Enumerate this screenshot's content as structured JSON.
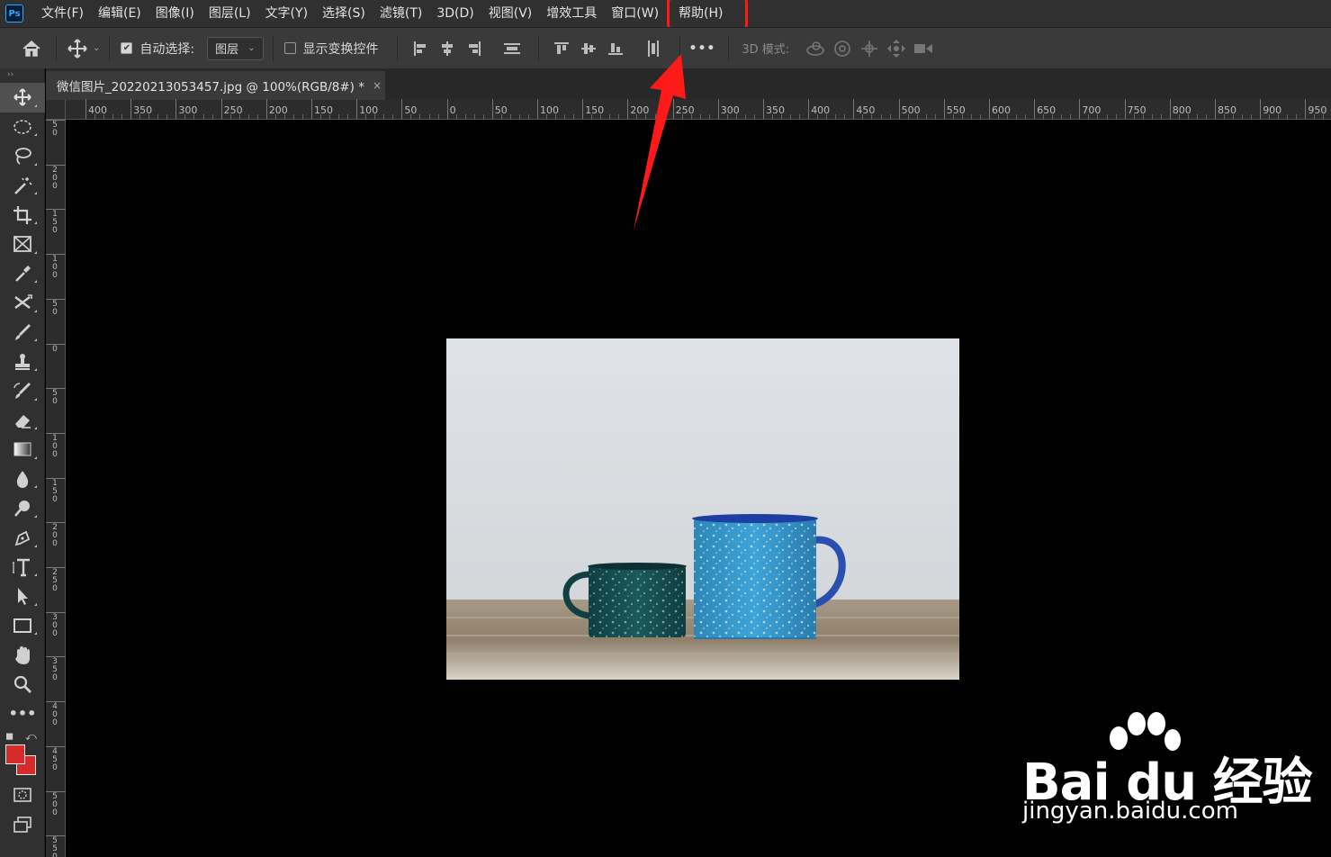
{
  "app": {
    "logo_text": "Ps"
  },
  "menu": [
    "文件(F)",
    "编辑(E)",
    "图像(I)",
    "图层(L)",
    "文字(Y)",
    "选择(S)",
    "滤镜(T)",
    "3D(D)",
    "视图(V)",
    "增效工具",
    "窗口(W)",
    "帮助(H)"
  ],
  "highlighted_menu": "帮助(H)",
  "options": {
    "auto_select_label": "自动选择:",
    "auto_select_checked": true,
    "auto_select_value": "图层",
    "show_transform_label": "显示变换控件",
    "show_transform_checked": false,
    "more_label": "•••",
    "mode_3d_label": "3D 模式:"
  },
  "document_tab": {
    "title": "微信图片_20220213053457.jpg @ 100%(RGB/8#) *",
    "close": "×"
  },
  "ruler_h_labels": [
    "400",
    "350",
    "300",
    "250",
    "200",
    "150",
    "100",
    "50",
    "0",
    "50",
    "100",
    "150",
    "200",
    "250",
    "300",
    "350",
    "400",
    "450",
    "500",
    "550",
    "600",
    "650",
    "700",
    "750",
    "800",
    "850",
    "900",
    "950"
  ],
  "ruler_v_labels": [
    "5\n0",
    "2\n0\n0",
    "1\n5\n0",
    "1\n0\n0",
    "5\n0",
    "0",
    "5\n0",
    "1\n0\n0",
    "1\n5\n0",
    "2\n0\n0",
    "2\n5\n0",
    "3\n0\n0",
    "3\n5\n0",
    "4\n0\n0",
    "4\n5\n0",
    "5\n0\n0",
    "5\n5\n0"
  ],
  "colors": {
    "foreground": "#d42b2b",
    "background": "#d42b2b",
    "annotation": "#ff1a1a"
  },
  "watermark": {
    "brand": "Bai du 经验",
    "url": "jingyan.baidu.com"
  }
}
